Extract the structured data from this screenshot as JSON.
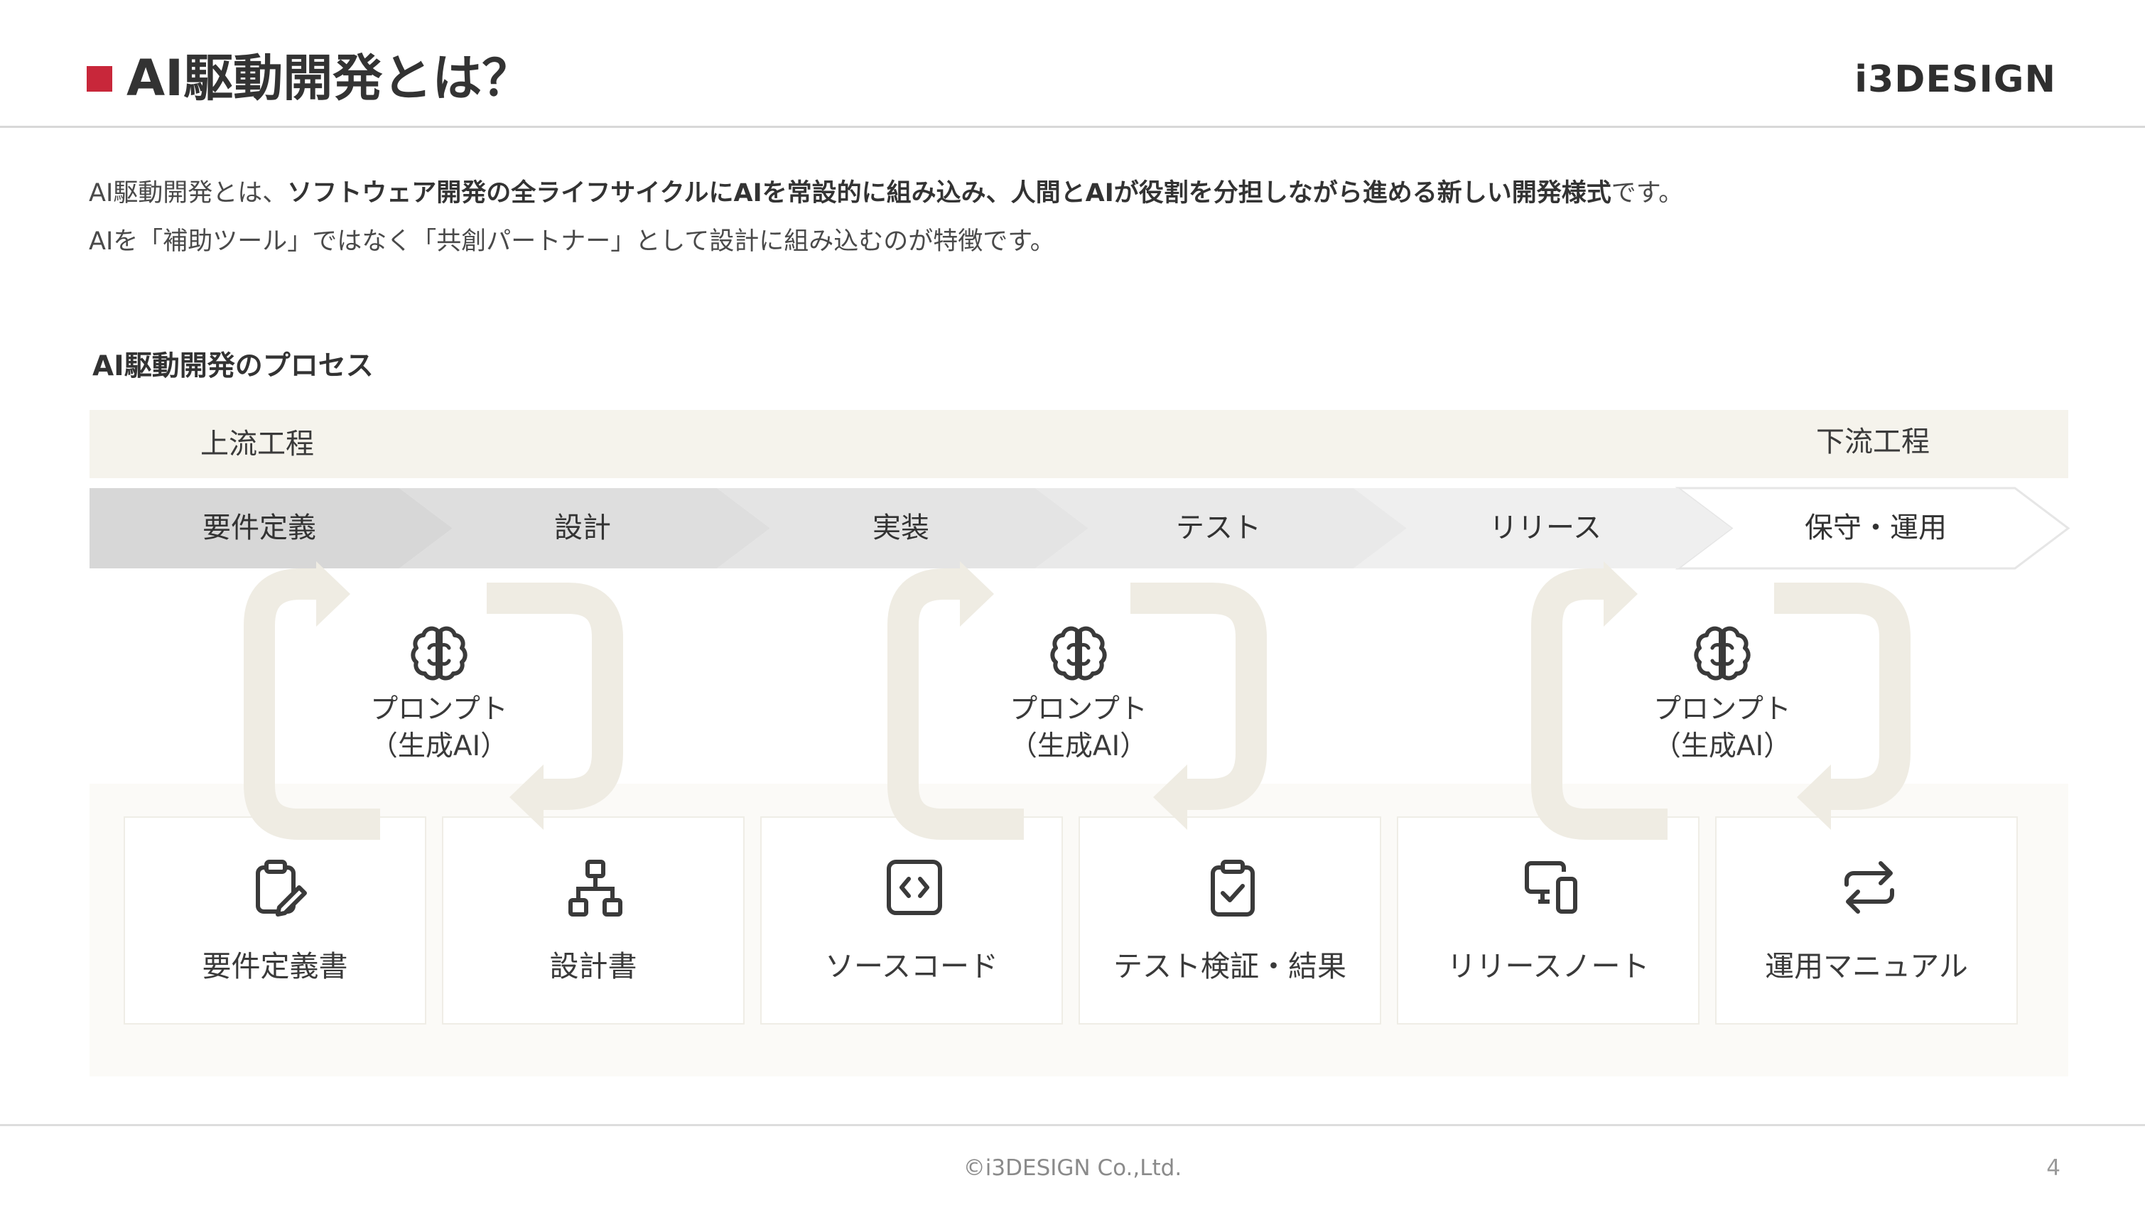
{
  "header": {
    "title": "AI駆動開発とは？",
    "logo": "i3DESIGN",
    "accent_color": "#c8273a"
  },
  "intro": {
    "line1_prefix": "AI駆動開発とは、",
    "line1_bold": "ソフトウェア開発の全ライフサイクルにAIを常設的に組み込み、人間とAIが役割を分担しながら進める新しい開発様式",
    "line1_suffix": "です。",
    "line2": "AIを「補助ツール」ではなく「共創パートナー」として設計に組み込むのが特徴です。"
  },
  "process": {
    "heading": "AI駆動開発のプロセス",
    "phase_upstream": "上流工程",
    "phase_downstream": "下流工程",
    "steps": [
      "要件定義",
      "設計",
      "実装",
      "テスト",
      "リリース",
      "保守・運用"
    ],
    "step_colors": [
      "#d7d7d7",
      "#dedede",
      "#e4e4e4",
      "#e9e9e9",
      "#efefef",
      "#ffffff"
    ],
    "prompt": {
      "label_line1": "プロンプト",
      "label_line2": "（生成AI）",
      "icon": "brain-icon"
    },
    "artifacts": [
      {
        "label": "要件定義書",
        "icon": "clipboard-edit-icon"
      },
      {
        "label": "設計書",
        "icon": "sitemap-icon"
      },
      {
        "label": "ソースコード",
        "icon": "code-icon"
      },
      {
        "label": "テスト検証・結果",
        "icon": "clipboard-check-icon"
      },
      {
        "label": "リリースノート",
        "icon": "devices-icon"
      },
      {
        "label": "運用マニュアル",
        "icon": "repeat-icon"
      }
    ]
  },
  "footer": {
    "copyright": "©i3DESIGN Co.,Ltd.",
    "page_number": "4"
  }
}
